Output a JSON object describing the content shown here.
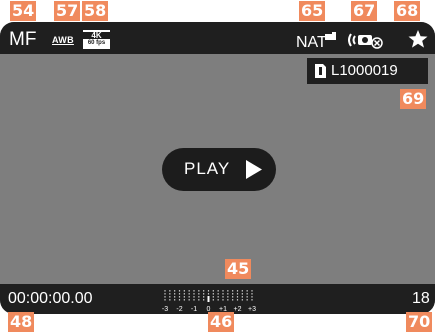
{
  "callouts": {
    "c54": "54",
    "c57": "57",
    "c58": "58",
    "c65": "65",
    "c67": "67",
    "c68": "68",
    "c69": "69",
    "c45": "45",
    "c48": "48",
    "c46": "46",
    "c70": "70"
  },
  "topbar": {
    "focus_mode": "MF",
    "white_balance": "AWB",
    "video_resolution": "4K",
    "frame_rate": "60 fps",
    "film_style": "NAT",
    "film_style_icon": "film-style-icon",
    "stabilization_icon": "image-stabilization-off-icon",
    "favorite_icon": "star-icon"
  },
  "file": {
    "icon": "memory-card-slot-icon",
    "card_slot": "1",
    "name": "L1000019"
  },
  "play_button": {
    "label": "PLAY",
    "icon": "play-triangle-icon"
  },
  "bottombar": {
    "timecode": "00:00:00.00",
    "clip_count": "18",
    "exposure_scale_labels": [
      "-3",
      "-2",
      "-1",
      "0",
      "+1",
      "+2",
      "+3"
    ],
    "exposure_value": 0
  },
  "colors": {
    "bar_bg": "#1f1f1f",
    "screen_bg": "#7e7e7e",
    "callout": "#f08a5d",
    "text": "#ffffff"
  }
}
